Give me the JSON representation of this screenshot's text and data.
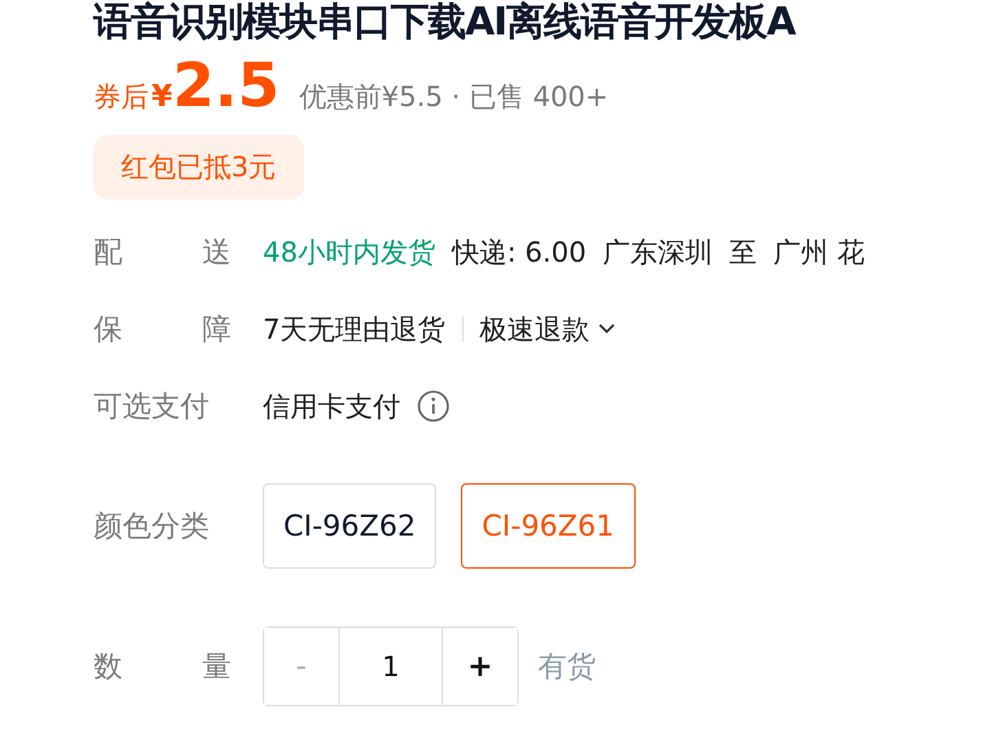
{
  "title": "语音识别模块串口下载AI离线语音开发板A",
  "price": {
    "prefix": "券后",
    "currency": "¥",
    "amount": "2.5",
    "original": "优惠前¥5.5 · 已售 400+"
  },
  "coupon_badge": "红包已抵3元",
  "delivery": {
    "label": "配送",
    "speed": "48小时内发货",
    "fee": "快递: 6.00",
    "from": "广东深圳",
    "to_word": "至",
    "to": "广州 花"
  },
  "guarantee": {
    "label": "保障",
    "items": [
      "7天无理由退货",
      "极速退款"
    ]
  },
  "payment": {
    "label": "可选支付",
    "method": "信用卡支付"
  },
  "color_options": {
    "label": "颜色分类",
    "options": [
      {
        "label": "CI-96Z62",
        "selected": false
      },
      {
        "label": "CI-96Z61",
        "selected": true
      }
    ]
  },
  "quantity": {
    "label": "数量",
    "minus": "-",
    "value": "1",
    "plus": "+",
    "minus_disabled": true,
    "stock": "有货"
  }
}
